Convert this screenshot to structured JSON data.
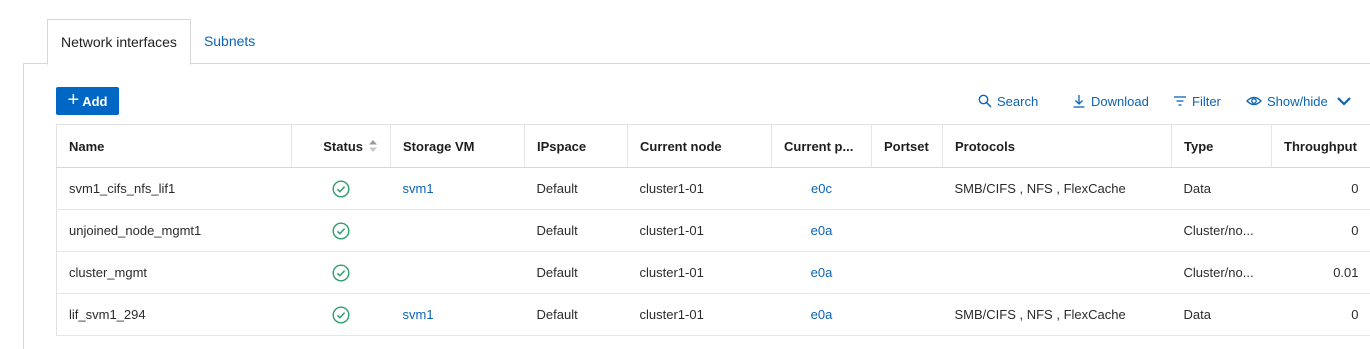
{
  "tabs": [
    {
      "label": "Network interfaces",
      "active": true
    },
    {
      "label": "Subnets",
      "active": false
    }
  ],
  "toolbar": {
    "add_label": "Add",
    "search_label": "Search",
    "download_label": "Download",
    "filter_label": "Filter",
    "showhide_label": "Show/hide"
  },
  "table": {
    "columns": [
      "Name",
      "Status",
      "Storage VM",
      "IPspace",
      "Current node",
      "Current p...",
      "Portset",
      "Protocols",
      "Type",
      "Throughput"
    ],
    "rows": [
      {
        "name": "svm1_cifs_nfs_lif1",
        "status": "ok-icon",
        "storage_vm": "svm1",
        "ipspace": "Default",
        "node": "cluster1-01",
        "port": "e0c",
        "portset": "",
        "protocols": "SMB/CIFS , NFS , FlexCache",
        "type": "Data",
        "throughput": "0"
      },
      {
        "name": "unjoined_node_mgmt1",
        "status": "ok-icon",
        "storage_vm": "",
        "ipspace": "Default",
        "node": "cluster1-01",
        "port": "e0a",
        "portset": "",
        "protocols": "",
        "type": "Cluster/no...",
        "throughput": "0"
      },
      {
        "name": "cluster_mgmt",
        "status": "ok-icon",
        "storage_vm": "",
        "ipspace": "Default",
        "node": "cluster1-01",
        "port": "e0a",
        "portset": "",
        "protocols": "",
        "type": "Cluster/no...",
        "throughput": "0.01"
      },
      {
        "name": "lif_svm1_294",
        "status": "ok-icon",
        "storage_vm": "svm1",
        "ipspace": "Default",
        "node": "cluster1-01",
        "port": "e0a",
        "portset": "",
        "protocols": "SMB/CIFS , NFS , FlexCache",
        "type": "Data",
        "throughput": "0"
      }
    ]
  },
  "colors": {
    "accent": "#0067c5",
    "link": "#0b64b4",
    "status_ok": "#2e9e6a"
  }
}
